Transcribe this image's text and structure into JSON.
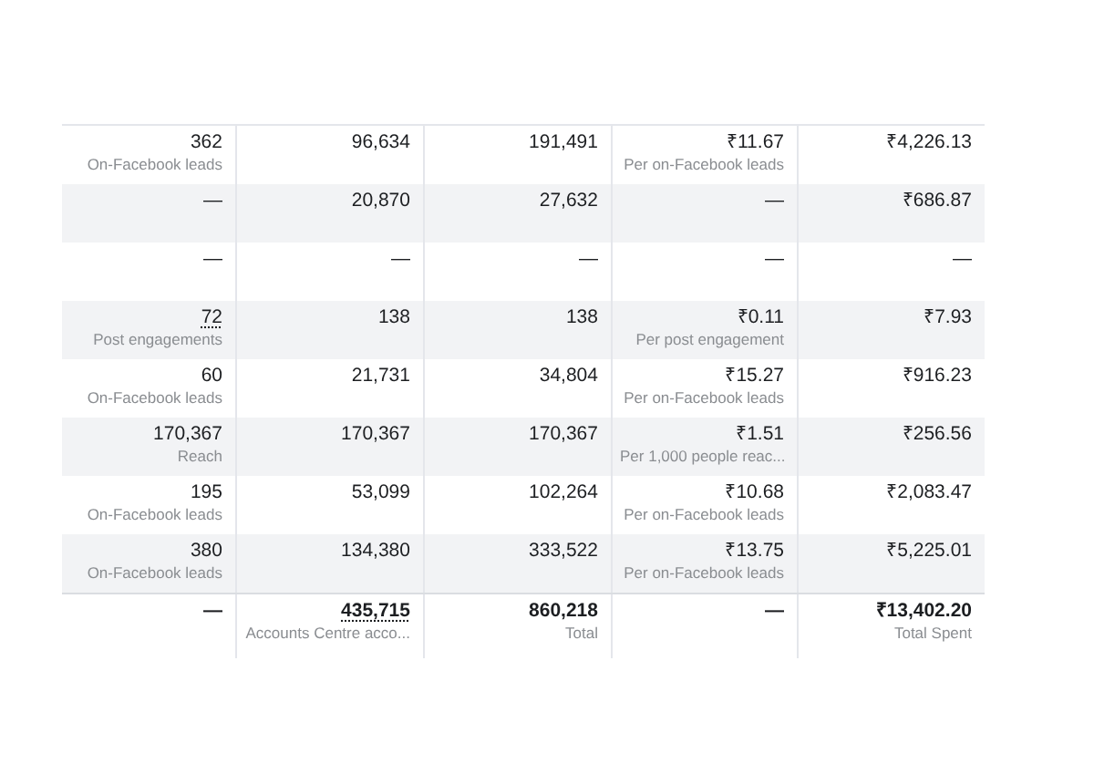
{
  "table": {
    "rows": [
      {
        "shaded": false,
        "total": false,
        "cells": [
          {
            "value": "362",
            "sub": "On-Facebook leads"
          },
          {
            "value": "96,634"
          },
          {
            "value": "191,491"
          },
          {
            "value": "₹11.67",
            "sub": "Per on-Facebook leads"
          },
          {
            "value": "₹4,226.13"
          }
        ]
      },
      {
        "shaded": true,
        "total": false,
        "cells": [
          {
            "value": "—"
          },
          {
            "value": "20,870"
          },
          {
            "value": "27,632"
          },
          {
            "value": "—"
          },
          {
            "value": "₹686.87"
          }
        ]
      },
      {
        "shaded": false,
        "total": false,
        "cells": [
          {
            "value": "—"
          },
          {
            "value": "—"
          },
          {
            "value": "—"
          },
          {
            "value": "—"
          },
          {
            "value": "—"
          }
        ]
      },
      {
        "shaded": true,
        "total": false,
        "cells": [
          {
            "value": "72",
            "sub": "Post engagements",
            "dotted": true
          },
          {
            "value": "138"
          },
          {
            "value": "138"
          },
          {
            "value": "₹0.11",
            "sub": "Per post engagement"
          },
          {
            "value": "₹7.93"
          }
        ]
      },
      {
        "shaded": false,
        "total": false,
        "cells": [
          {
            "value": "60",
            "sub": "On-Facebook leads"
          },
          {
            "value": "21,731"
          },
          {
            "value": "34,804"
          },
          {
            "value": "₹15.27",
            "sub": "Per on-Facebook leads"
          },
          {
            "value": "₹916.23"
          }
        ]
      },
      {
        "shaded": true,
        "total": false,
        "cells": [
          {
            "value": "170,367",
            "sub": "Reach"
          },
          {
            "value": "170,367"
          },
          {
            "value": "170,367"
          },
          {
            "value": "₹1.51",
            "sub": "Per 1,000 people reac..."
          },
          {
            "value": "₹256.56"
          }
        ]
      },
      {
        "shaded": false,
        "total": false,
        "cells": [
          {
            "value": "195",
            "sub": "On-Facebook leads"
          },
          {
            "value": "53,099"
          },
          {
            "value": "102,264"
          },
          {
            "value": "₹10.68",
            "sub": "Per on-Facebook leads"
          },
          {
            "value": "₹2,083.47"
          }
        ]
      },
      {
        "shaded": true,
        "total": false,
        "cells": [
          {
            "value": "380",
            "sub": "On-Facebook leads"
          },
          {
            "value": "134,380"
          },
          {
            "value": "333,522"
          },
          {
            "value": "₹13.75",
            "sub": "Per on-Facebook leads"
          },
          {
            "value": "₹5,225.01"
          }
        ]
      },
      {
        "shaded": false,
        "total": true,
        "cells": [
          {
            "value": "—"
          },
          {
            "value": "435,715",
            "sub": "Accounts Centre acco...",
            "dotted": true
          },
          {
            "value": "860,218",
            "sub": "Total"
          },
          {
            "value": "—"
          },
          {
            "value": "₹13,402.20",
            "sub": "Total Spent"
          }
        ]
      }
    ]
  }
}
